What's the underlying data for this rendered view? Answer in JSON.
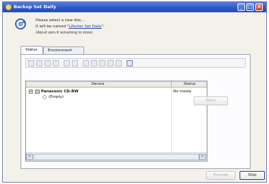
{
  "window": {
    "title": "Backup Set Daily",
    "buttons": [
      "minimize",
      "maximize",
      "close"
    ]
  },
  "message": {
    "line1": "Please select a new disc...",
    "line2_prefix": "It will be named \"",
    "line2_link": "Lifecker Set Daily",
    "line2_suffix": "\".",
    "line3": "(About zero K remaining to store)"
  },
  "tabs": [
    {
      "label": "Status",
      "active": true
    },
    {
      "label": "Environment",
      "active": false
    }
  ],
  "toolbar": {
    "icons": [
      "tool-icon-1",
      "tool-icon-2",
      "tool-icon-3",
      "tool-icon-4",
      "tool-icon-5",
      "tool-icon-6",
      "tool-icon-7",
      "tool-icon-8",
      "tool-icon-9",
      "tool-icon-10",
      "tool-icon-11",
      "tool-icon-12"
    ]
  },
  "grid": {
    "columns": [
      "Device",
      "Status"
    ],
    "rows": [
      {
        "expander": "⊟",
        "device": "Panasonic CD-RW",
        "status": "No media"
      },
      {
        "device": "(Empty)",
        "status": ""
      }
    ]
  },
  "buttons": {
    "eject": "Eject",
    "proceed": "Proceed",
    "stop": "Stop"
  },
  "colors": {
    "titlebar": "#2a56c6",
    "link": "#1a3d99"
  }
}
